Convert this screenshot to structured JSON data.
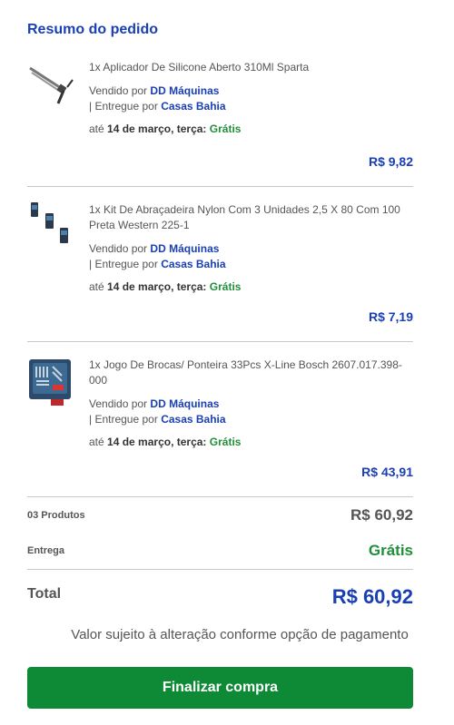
{
  "summary": {
    "title": "Resumo do pedido"
  },
  "items": [
    {
      "name": "1x Aplicador De Silicone Aberto 310Ml Sparta",
      "sold_by_label": "Vendido por",
      "seller": "DD Máquinas",
      "delivered_by_label": "| Entregue por",
      "deliverer": "Casas Bahia",
      "eta_prefix": "até",
      "eta_date": "14 de março, terça:",
      "shipping": "Grátis",
      "price": "R$ 9,82",
      "image_icon": "caulk-gun-icon"
    },
    {
      "name": "1x Kit De Abraçadeira Nylon Com 3 Unidades 2,5 X 80 Com 100 Preta Western 225-1",
      "sold_by_label": "Vendido por",
      "seller": "DD Máquinas",
      "delivered_by_label": "| Entregue por",
      "deliverer": "Casas Bahia",
      "eta_prefix": "até",
      "eta_date": "14 de março, terça:",
      "shipping": "Grátis",
      "price": "R$ 7,19",
      "image_icon": "cable-tie-packs-icon"
    },
    {
      "name": "1x Jogo De Brocas/ Ponteira 33Pcs X-Line Bosch 2607.017.398-000",
      "sold_by_label": "Vendido por",
      "seller": "DD Máquinas",
      "delivered_by_label": "| Entregue por",
      "deliverer": "Casas Bahia",
      "eta_prefix": "até",
      "eta_date": "14 de março, terça:",
      "shipping": "Grátis",
      "price": "R$ 43,91",
      "image_icon": "drill-bit-case-icon"
    }
  ],
  "totals": {
    "products_label": "03 Produtos",
    "products_value": "R$ 60,92",
    "shipping_label": "Entrega",
    "shipping_value": "Grátis",
    "total_label": "Total",
    "total_value": "R$ 60,92"
  },
  "note": "Valor sujeito à alteração conforme opção de pagamento",
  "checkout_button": "Finalizar compra",
  "colors": {
    "brand_blue": "#1a3fb4",
    "green": "#1f8f3a",
    "button_green": "#0e8a37"
  }
}
